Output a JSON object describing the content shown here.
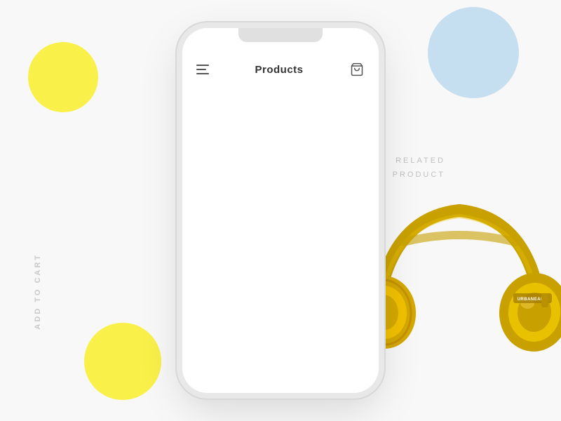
{
  "background": {
    "color": "#f8f8f8"
  },
  "decorative": {
    "circle_yellow_top": {
      "color": "#f9f04a"
    },
    "circle_blue_top": {
      "color": "#c5dff0"
    },
    "circle_yellow_bottom": {
      "color": "#f9f04a"
    }
  },
  "sidebar_text": "ADD TO CART",
  "related_product_line1": "RELATED",
  "related_product_line2": "PRODUCT",
  "header": {
    "title": "Products",
    "menu_icon": "☰",
    "cart_icon": "cart"
  }
}
